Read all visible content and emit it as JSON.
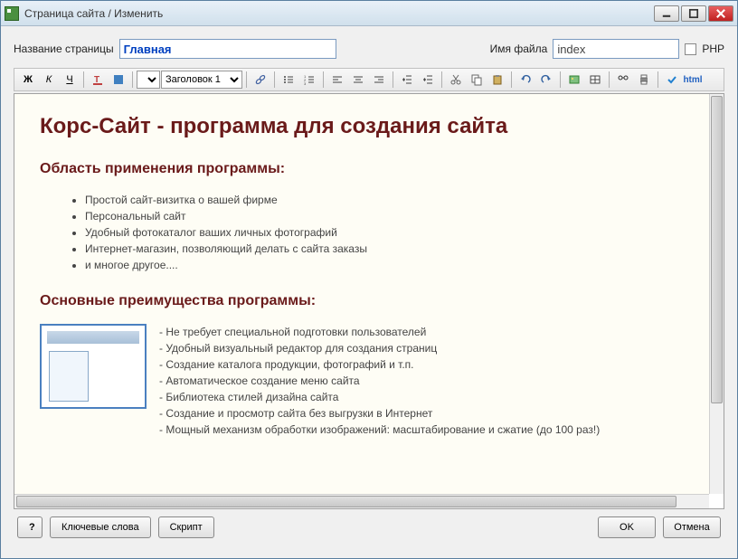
{
  "window": {
    "title": "Страница сайта / Изменить"
  },
  "fields": {
    "page_label": "Название страницы",
    "page_value": "Главная",
    "file_label": "Имя файла",
    "file_value": "index",
    "php_label": "PHP"
  },
  "toolbar": {
    "bold": "Ж",
    "italic": "К",
    "underline": "Ч",
    "heading_selected": "Заголовок 1",
    "html_label": "html"
  },
  "content": {
    "h1": "Корс-Сайт - программа для создания сайта",
    "h2a": "Область применения программы:",
    "list1": [
      "Простой сайт-визитка о вашей фирме",
      "Персональный сайт",
      "Удобный фотокаталог ваших личных фотографий",
      "Интернет-магазин, позволяющий делать с сайта заказы",
      "и многое другое...."
    ],
    "h2b": "Основные преимущества программы:",
    "list2": [
      "- Не требует специальной подготовки пользователей",
      "- Удобный визуальный редактор для создания страниц",
      "- Создание каталога продукции, фотографий и т.п.",
      "- Автоматическое создание меню сайта",
      "- Библиотека стилей дизайна сайта",
      "- Создание и просмотр сайта без выгрузки в Интернет",
      "- Мощный механизм обработки изображений: масштабирование и сжатие (до 100 раз!)"
    ]
  },
  "footer": {
    "help": "?",
    "keywords": "Ключевые слова",
    "script": "Скрипт",
    "ok": "OK",
    "cancel": "Отмена"
  }
}
